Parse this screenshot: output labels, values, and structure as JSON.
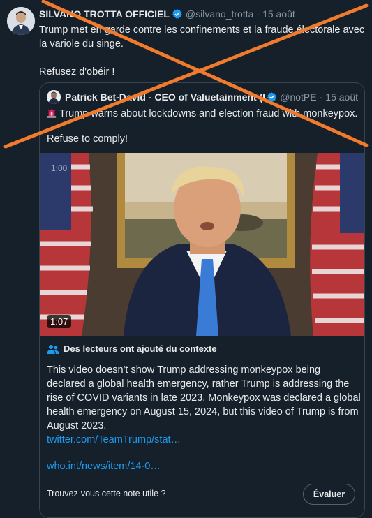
{
  "tweet": {
    "author_name": "SILVANO TROTTA OFFICIEL",
    "handle": "@silvano_trotta",
    "separator": "·",
    "date": "15 août",
    "text_line1": "Trump met en garde contre les confinements et la fraude électorale avec la variole du singe.",
    "text_line2": "Refusez d'obéir !"
  },
  "quoted": {
    "author_name": "Patrick Bet-David - CEO of Valuetainment (Pa",
    "handle": "@notPE",
    "separator": "·",
    "date": "15 août",
    "text_line1": "Trump warns about lockdowns and election fraud with monkeypox.",
    "text_line2": "Refuse to comply!",
    "video_duration": "1:07",
    "video_counter": "1:00"
  },
  "community_note": {
    "title": "Des lecteurs ont ajouté du contexte",
    "body": "This video doesn't show Trump addressing monkeypox being declared a global health emergency, rather Trump is addressing the rise of COVID variants in late 2023. Monkeypox was declared a global health emergency on August 15, 2024, but this video of Trump is from August 2023.",
    "link1": "twitter.com/TeamTrump/stat…",
    "link2": "who.int/news/item/14-0…",
    "question": "Trouvez-vous cette note utile ?",
    "rate_label": "Évaluer"
  },
  "colors": {
    "background": "#15202b",
    "link": "#1d9bf0",
    "verified": "#1d9bf0",
    "cross": "#f07b2c"
  },
  "icons": [
    "verified-badge-icon",
    "siren-icon",
    "people-icon"
  ]
}
